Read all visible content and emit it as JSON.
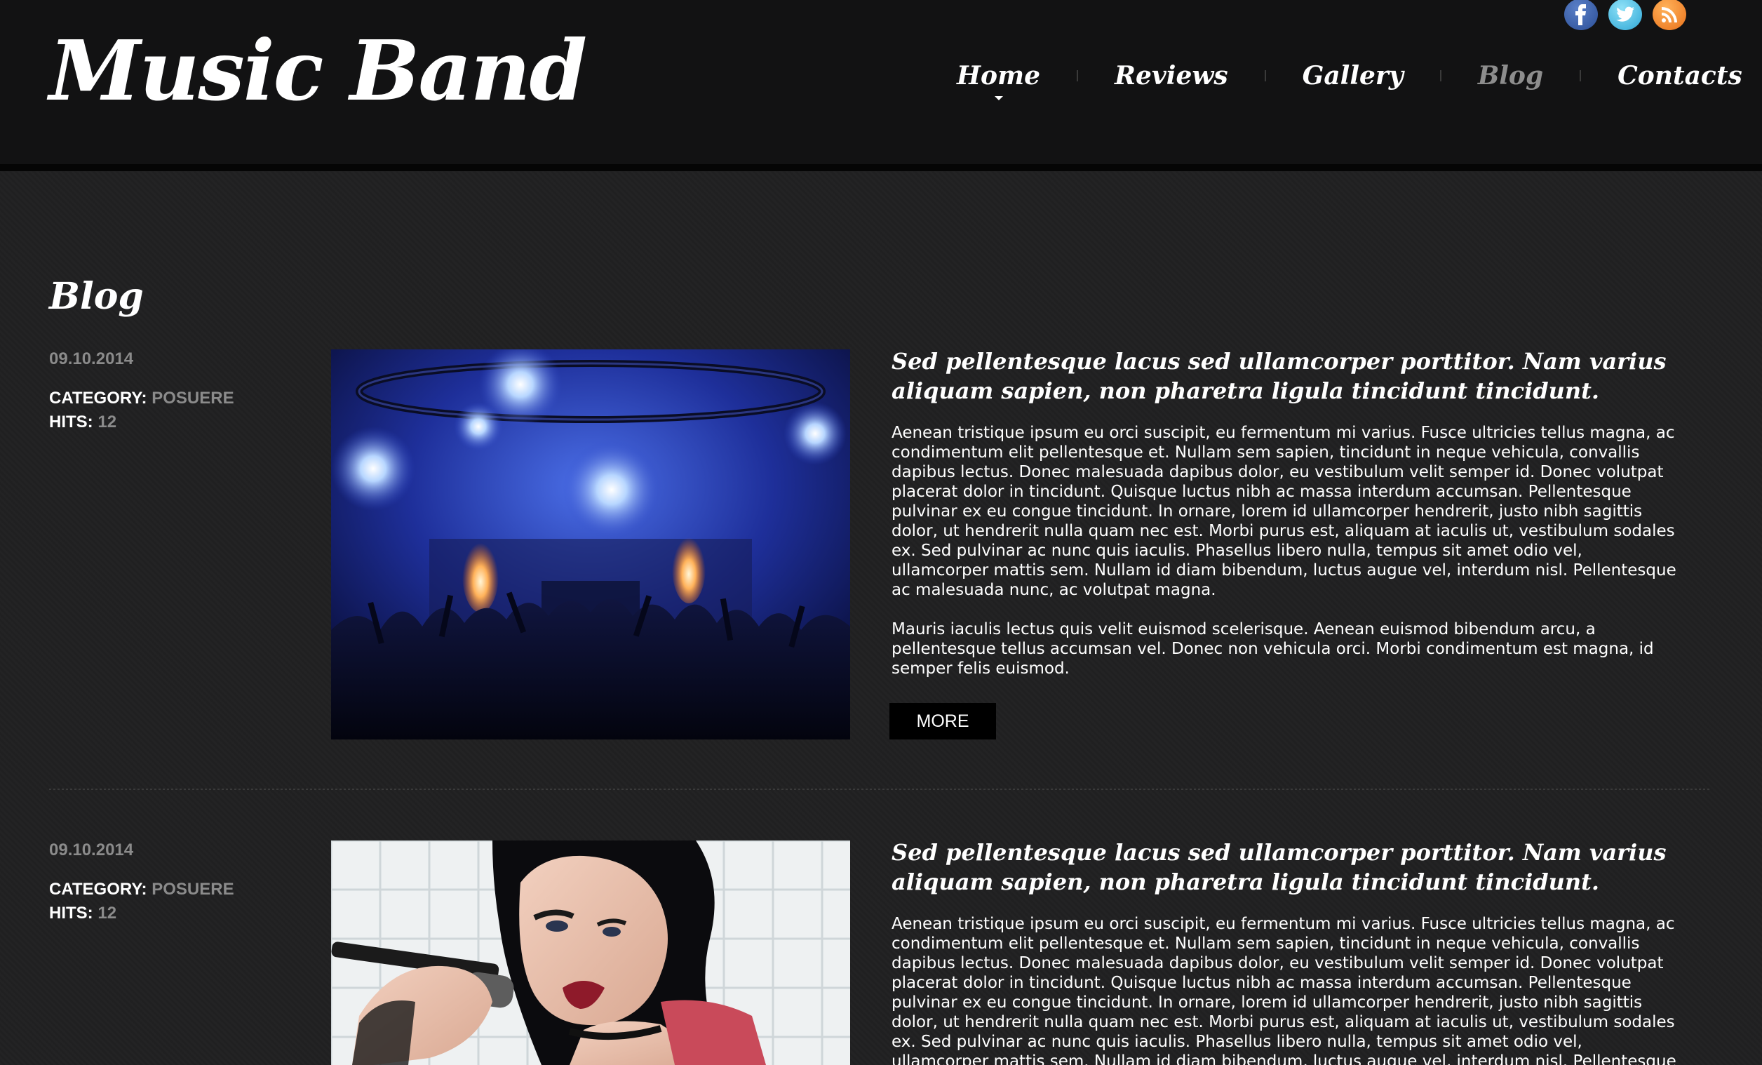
{
  "site": {
    "logo": "Music Band",
    "nav": [
      {
        "label": "Home",
        "active": false
      },
      {
        "label": "Reviews",
        "active": false
      },
      {
        "label": "Gallery",
        "active": false
      },
      {
        "label": "Blog",
        "active": true
      },
      {
        "label": "Contacts",
        "active": false
      }
    ],
    "social": [
      "facebook-icon",
      "twitter-icon",
      "rss-icon"
    ]
  },
  "page": {
    "title": "Blog"
  },
  "posts": [
    {
      "date": "09.10.2014",
      "category_label": "CATEGORY:",
      "category": "POSUERE",
      "hits_label": "HITS:",
      "hits": "12",
      "heading": "Sed pellentesque lacus sed ullamcorper porttitor. Nam varius aliquam sapien, non pharetra ligula tincidunt tincidunt.",
      "body": [
        "Aenean tristique ipsum eu orci suscipit, eu fermentum mi varius. Fusce ultricies tellus magna, ac condimentum elit pellentesque et. Nullam sem sapien, tincidunt in neque vehicula, convallis dapibus lectus. Donec malesuada dapibus dolor, eu vestibulum velit semper id. Donec volutpat placerat dolor in tincidunt. Quisque luctus nibh ac massa interdum accumsan. Pellentesque pulvinar ex eu congue tincidunt. In ornare, lorem id ullamcorper hendrerit, justo nibh sagittis dolor, ut hendrerit nulla quam nec est. Morbi purus est, aliquam at iaculis ut, vestibulum sodales ex. Sed pulvinar ac nunc quis iaculis. Phasellus libero nulla, tempus sit amet odio vel, ullamcorper mattis sem. Nullam id diam bibendum, luctus augue vel, interdum nisl. Pellentesque ac malesuada nunc, ac volutpat magna.",
        "Mauris iaculis lectus quis velit euismod scelerisque. Aenean euismod bibendum arcu, a pellentesque tellus accumsan vel. Donec non vehicula orci. Morbi condimentum est magna, id semper felis euismod."
      ],
      "more_label": "MORE"
    },
    {
      "date": "09.10.2014",
      "category_label": "CATEGORY:",
      "category": "POSUERE",
      "hits_label": "HITS:",
      "hits": "12",
      "heading": "Sed pellentesque lacus sed ullamcorper porttitor. Nam varius aliquam sapien, non pharetra ligula tincidunt tincidunt.",
      "body": [
        "Aenean tristique ipsum eu orci suscipit, eu fermentum mi varius. Fusce ultricies tellus magna, ac condimentum elit pellentesque et. Nullam sem sapien, tincidunt in neque vehicula, convallis dapibus lectus. Donec malesuada dapibus dolor, eu vestibulum velit semper id. Donec volutpat placerat dolor in tincidunt. Quisque luctus nibh ac massa interdum accumsan. Pellentesque pulvinar ex eu congue tincidunt. In ornare, lorem id ullamcorper hendrerit, justo nibh sagittis dolor, ut hendrerit nulla quam nec est. Morbi purus est, aliquam at iaculis ut, vestibulum sodales ex. Sed pulvinar ac nunc quis iaculis. Phasellus libero nulla, tempus sit amet odio vel, ullamcorper mattis sem. Nullam id diam bibendum, luctus augue vel, interdum nisl. Pellentesque ac malesuada nunc, ac volutpat magna."
      ]
    }
  ],
  "colors": {
    "header_bg": "#121213",
    "body_bg": "#222223",
    "muted_text": "#8b8b8b",
    "active_nav": "#8d8d8d"
  }
}
